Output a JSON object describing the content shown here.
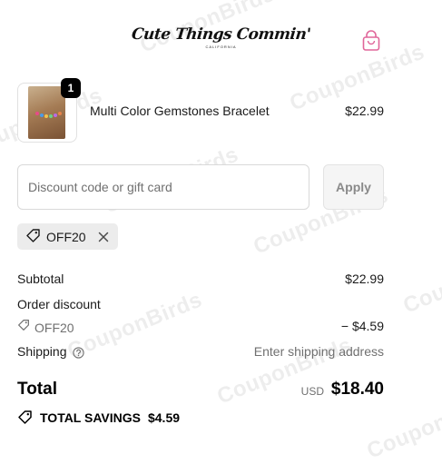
{
  "header": {
    "logo_text": "Cute Things Commin'",
    "logo_sub": "CALIFORNIA",
    "cart_icon": "shopping-bag-icon"
  },
  "line_item": {
    "quantity": "1",
    "name": "Multi Color Gemstones Bracelet",
    "price": "$22.99"
  },
  "discount": {
    "placeholder": "Discount code or gift card",
    "value": "",
    "apply_label": "Apply",
    "applied_code": "OFF20"
  },
  "summary": {
    "subtotal_label": "Subtotal",
    "subtotal_value": "$22.99",
    "order_discount_label": "Order discount",
    "order_discount_code": "OFF20",
    "order_discount_value": "− $4.59",
    "shipping_label": "Shipping",
    "shipping_value": "Enter shipping address",
    "total_label": "Total",
    "total_currency": "USD",
    "total_value": "$18.40",
    "savings_label": "TOTAL SAVINGS",
    "savings_value": "$4.59"
  },
  "watermark": "CouponBirds",
  "colors": {
    "text": "#1a1a1a",
    "muted": "#707070",
    "chip_bg": "#ececec",
    "accent_pink": "#e0669a"
  }
}
